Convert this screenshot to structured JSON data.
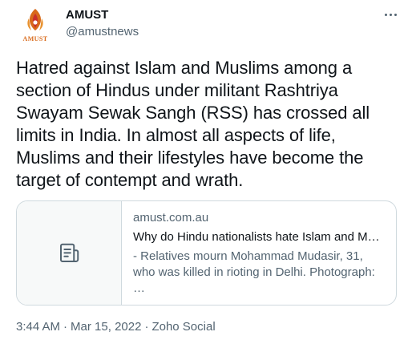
{
  "author": {
    "name": "AMUST",
    "handle": "@amustnews",
    "avatar_text": "AMUST",
    "avatar_icon": "amust-logo-icon"
  },
  "menu": {
    "icon": "more-horizontal-icon"
  },
  "tweet": {
    "text": "Hatred against Islam and Muslims among a section of Hindus under militant Rashtriya Swayam Sewak Sangh (RSS) has crossed all limits in India. In almost all aspects of life, Muslims and their lifestyles have become the target of contempt and wrath."
  },
  "link_card": {
    "thumb_icon": "article-document-icon",
    "domain": "amust.com.au",
    "title": "Why do Hindu nationalists hate Islam and Mu…",
    "description": "- Relatives mourn Mohammad Mudasir, 31, who was killed in rioting in Delhi. Photograph: …"
  },
  "meta": {
    "time": "3:44 AM",
    "separator": "·",
    "date": "Mar 15, 2022",
    "source": "Zoho Social"
  },
  "colors": {
    "text": "#0f1419",
    "secondary": "#536471",
    "border": "#cfd9de",
    "brand_orange": "#d8691a",
    "brand_red": "#c8302c"
  }
}
